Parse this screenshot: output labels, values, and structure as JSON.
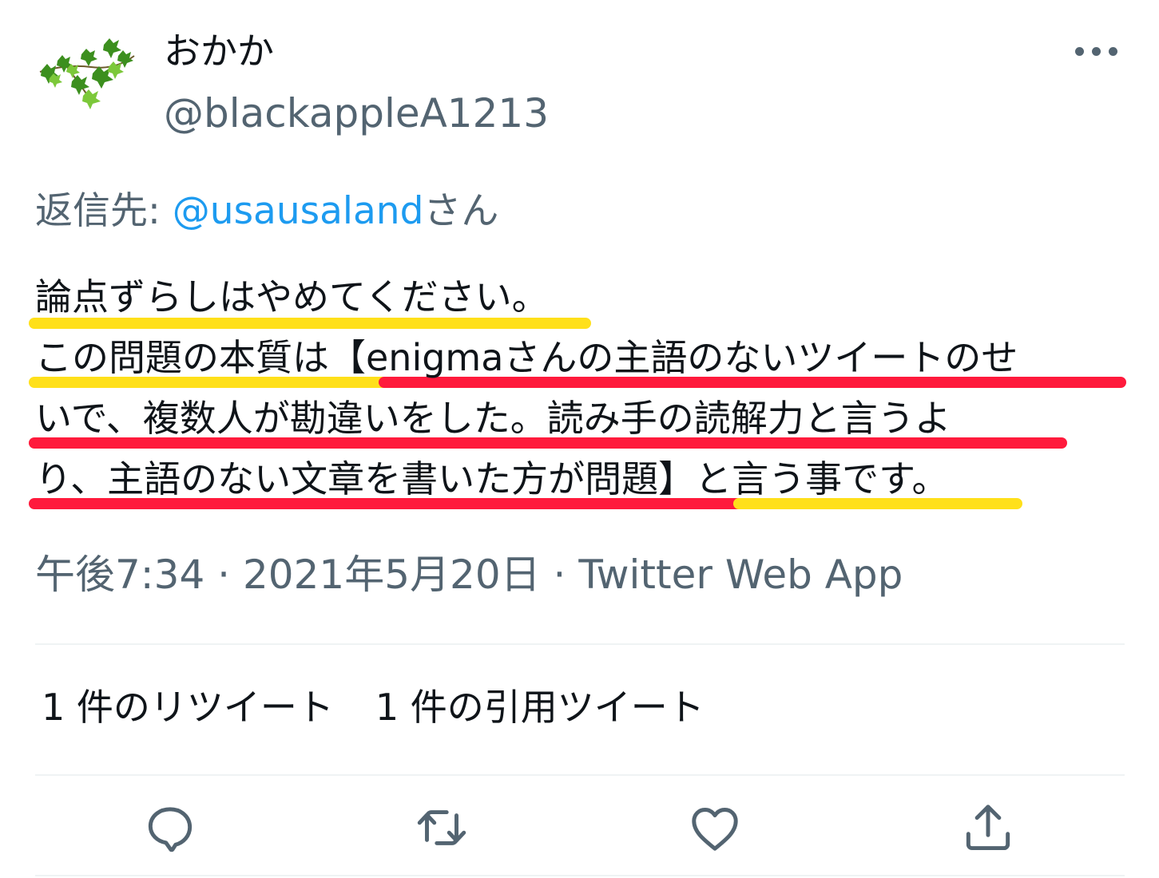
{
  "author": {
    "display_name": "おかか",
    "username": "@blackappleA1213",
    "avatar_icon": "ivy-leaves-avatar-icon"
  },
  "menu": {
    "icon": "more-horizontal-icon"
  },
  "reply": {
    "prefix": "返信先: ",
    "mention": "@usausaland",
    "suffix": "さん"
  },
  "body": {
    "lines": [
      "論点ずらしはやめてください。",
      "この問題の本質は【enigmaさんの主語のないツイートのせ",
      "いで、複数人が勘違いをした。読み手の読解力と言うよ",
      "り、主語のない文章を書いた方が問題】と言う事です。"
    ]
  },
  "meta": {
    "time": "午後7:34",
    "separator": " · ",
    "date": "2021年5月20日",
    "separator2": " · ",
    "source": "Twitter Web App"
  },
  "stats": {
    "retweets": "1 件のリツイート",
    "quotes": "1 件の引用ツイート"
  },
  "actions": [
    {
      "icon": "reply-icon"
    },
    {
      "icon": "retweet-icon"
    },
    {
      "icon": "like-heart-icon"
    },
    {
      "icon": "share-icon"
    }
  ],
  "colors": {
    "text": "#0f1419",
    "secondary": "#536471",
    "link": "#1d9bf0",
    "highlight_yellow": "#ffe01a",
    "highlight_red": "#ff1a3c"
  }
}
